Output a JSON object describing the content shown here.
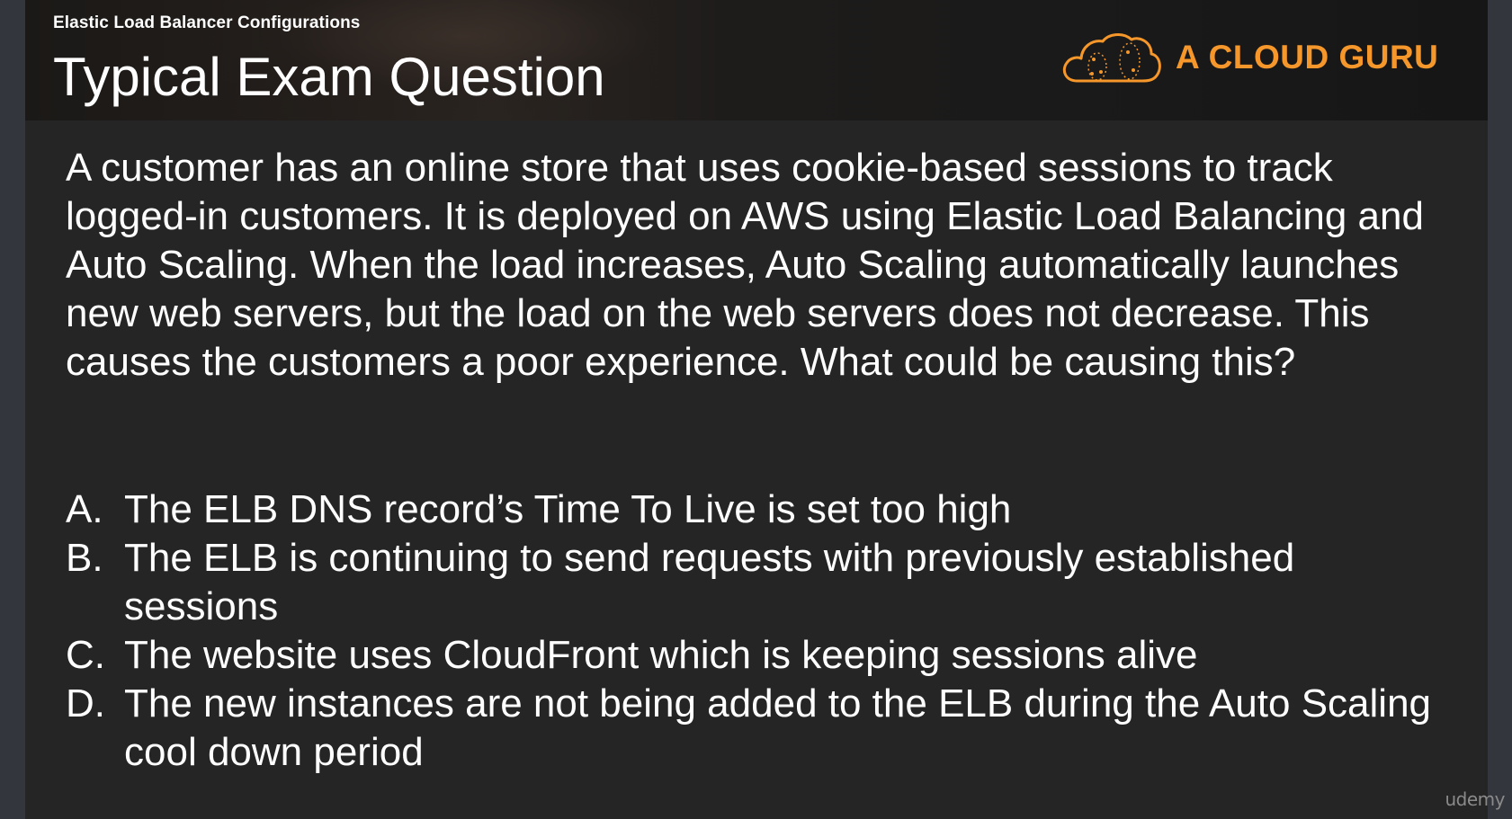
{
  "header": {
    "section_label": "Elastic Load Balancer Configurations",
    "title": "Typical Exam Question",
    "brand_name": "A CLOUD GURU",
    "brand_color": "#f5972a"
  },
  "question": {
    "text": "A customer has an online store that uses cookie-based sessions to track logged-in customers. It is deployed on AWS using Elastic Load Balancing and Auto Scaling. When the load increases, Auto Scaling automatically launches new web servers, but the load on the web servers does not decrease. This causes the customers a poor experience. What could be causing this?"
  },
  "options": [
    {
      "letter": "A.",
      "text": "The ELB DNS record’s Time To Live is set too high"
    },
    {
      "letter": "B.",
      "text": "The ELB is continuing to send requests with previously established sessions"
    },
    {
      "letter": "C.",
      "text": "The website uses CloudFront which is keeping sessions alive"
    },
    {
      "letter": "D.",
      "text": "The new instances are not being added to the ELB during the Auto Scaling cool down period"
    }
  ],
  "watermark": "udemy"
}
